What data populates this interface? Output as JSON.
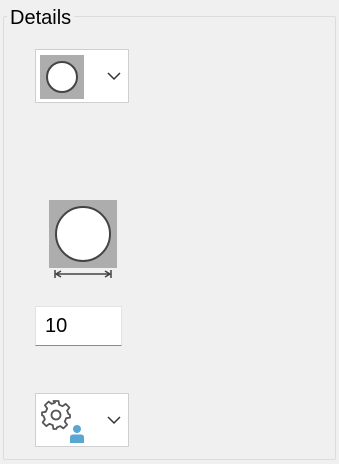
{
  "group": {
    "title": "Details"
  },
  "shape_dropdown": {
    "selected_icon": "circle-icon",
    "expand_icon": "chevron-down-icon"
  },
  "preview": {
    "shape_icon": "circle-icon",
    "measure_icon": "diameter-arrow-icon"
  },
  "size_field": {
    "value": "10"
  },
  "settings_dropdown": {
    "selected_icon": "gear-user-icon",
    "expand_icon": "chevron-down-icon"
  },
  "colors": {
    "background": "#f0f0f0",
    "swatch_gray": "#adadad",
    "shape_stroke": "#444444",
    "user_blue": "#5aa6d2"
  }
}
